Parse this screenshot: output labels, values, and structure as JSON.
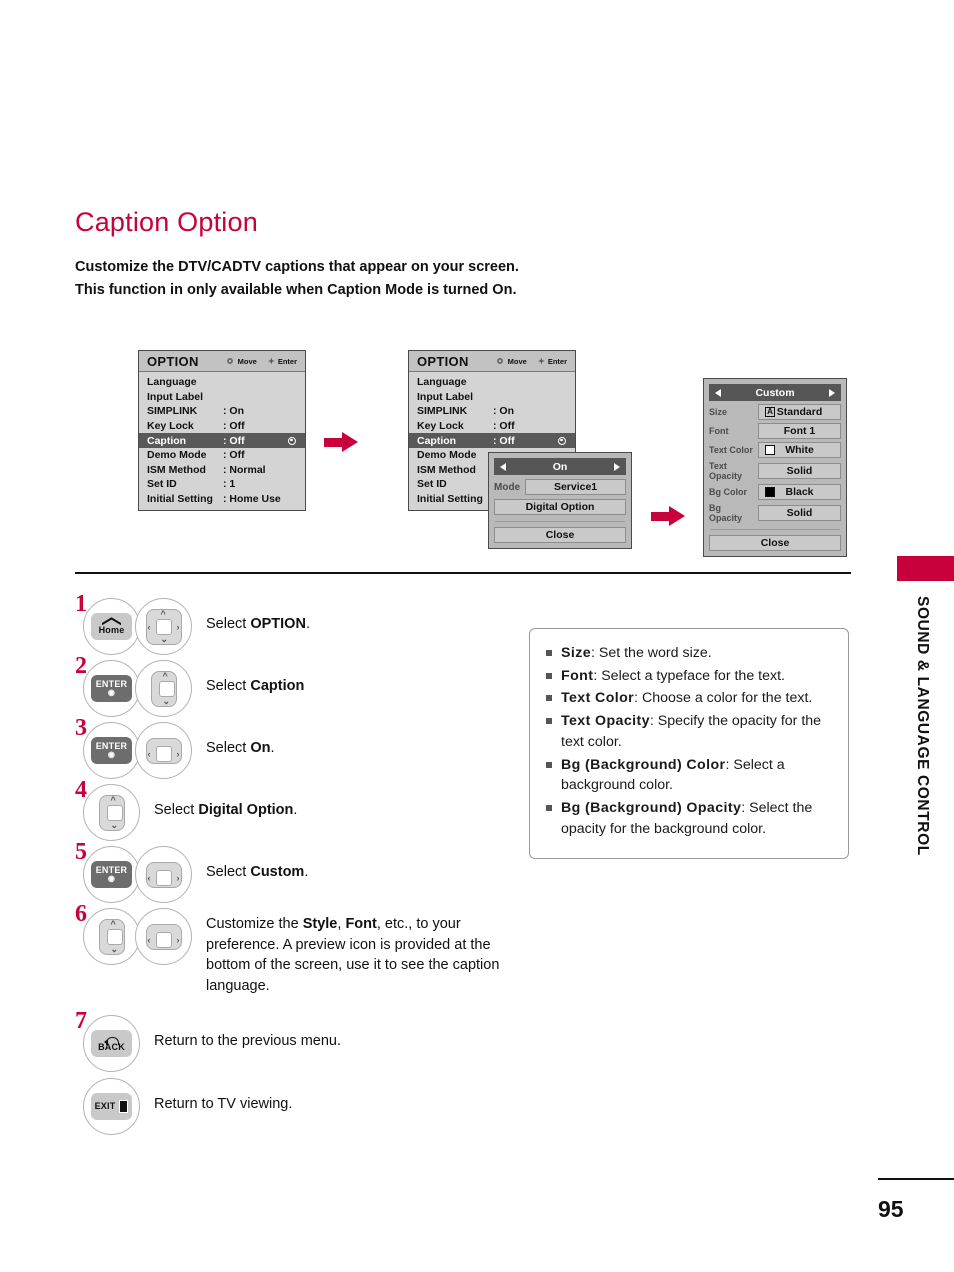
{
  "page": {
    "title": "Caption Option",
    "intro_line1": "Customize the DTV/CADTV captions that appear on your screen.",
    "intro_line2": "This function in only available when Caption Mode is turned On.",
    "side_label": "SOUND & LANGUAGE CONTROL",
    "page_number": "95",
    "accent_color": "#c8003c"
  },
  "osd1": {
    "title": "OPTION",
    "hint_move": "Move",
    "hint_enter": "Enter",
    "rows": [
      {
        "label": "Language",
        "value": ""
      },
      {
        "label": "Input Label",
        "value": ""
      },
      {
        "label": "SIMPLINK",
        "value": ": On"
      },
      {
        "label": "Key Lock",
        "value": ": Off"
      },
      {
        "label": "Caption",
        "value": ": Off"
      },
      {
        "label": "Demo Mode",
        "value": ": Off"
      },
      {
        "label": "ISM Method",
        "value": ": Normal"
      },
      {
        "label": "Set ID",
        "value": ": 1"
      },
      {
        "label": "Initial Setting",
        "value": ": Home Use"
      }
    ]
  },
  "osd2": {
    "title": "OPTION",
    "hint_move": "Move",
    "hint_enter": "Enter",
    "rows": [
      {
        "label": "Language",
        "value": ""
      },
      {
        "label": "Input Label",
        "value": ""
      },
      {
        "label": "SIMPLINK",
        "value": ": On"
      },
      {
        "label": "Key Lock",
        "value": ": Off"
      },
      {
        "label": "Caption",
        "value": ": Off"
      },
      {
        "label": "Demo Mode",
        "value": ""
      },
      {
        "label": "ISM Method",
        "value": ""
      },
      {
        "label": "Set ID",
        "value": ""
      },
      {
        "label": "Initial Setting",
        "value": ""
      }
    ]
  },
  "caption_popup": {
    "state": "On",
    "mode_label": "Mode",
    "mode_value": "Service1",
    "digital_option": "Digital Option",
    "close": "Close"
  },
  "custom_panel": {
    "title": "Custom",
    "rows": [
      {
        "label": "Size",
        "value": "Standard",
        "swatch": "letter-a-icon"
      },
      {
        "label": "Font",
        "value": "Font 1",
        "swatch": ""
      },
      {
        "label": "Text Color",
        "value": "White",
        "swatch": "white-swatch"
      },
      {
        "label": "Text Opacity",
        "value": "Solid",
        "swatch": ""
      },
      {
        "label": "Bg Color",
        "value": "Black",
        "swatch": "black-swatch"
      },
      {
        "label": "Bg Opacity",
        "value": "Solid",
        "swatch": ""
      }
    ],
    "close": "Close",
    "size_glyph": "A"
  },
  "steps": [
    {
      "num": "1",
      "keys": [
        "home-button",
        "nav-pad-4way"
      ],
      "text_html": "Select <b>OPTION</b>."
    },
    {
      "num": "2",
      "keys": [
        "enter-button",
        "nav-pad-updown"
      ],
      "text_html": "Select <b>Caption</b>"
    },
    {
      "num": "3",
      "keys": [
        "enter-button",
        "nav-pad-leftright"
      ],
      "text_html": "Select <b>On</b>."
    },
    {
      "num": "4",
      "keys": [
        "nav-pad-updown"
      ],
      "text_html": "Select <b>Digital Option</b>."
    },
    {
      "num": "5",
      "keys": [
        "enter-button",
        "nav-pad-leftright"
      ],
      "text_html": "Select <b>Custom</b>."
    },
    {
      "num": "6",
      "keys": [
        "nav-pad-updown",
        "nav-pad-leftright"
      ],
      "text_html": "Customize the <b>Style</b>, <b>Font</b>, etc., to your preference. A preview icon is provided at the bottom of the screen, use it to see the caption language."
    },
    {
      "num": "7",
      "keys": [
        "back-button"
      ],
      "text_html": "Return to the previous menu."
    },
    {
      "num": "",
      "keys": [
        "exit-button"
      ],
      "text_html": "Return to TV viewing."
    }
  ],
  "key_labels": {
    "home": "Home",
    "enter_line1": "ENTER",
    "back": "BACK",
    "exit": "EXIT"
  },
  "infobox": [
    {
      "term": "Size",
      "desc": ": Set the word size."
    },
    {
      "term": "Font",
      "desc": ": Select a typeface for the text."
    },
    {
      "term": "Text Color",
      "desc": ": Choose a color for the text."
    },
    {
      "term": "Text Opacity",
      "desc": ": Specify the opacity for the text color."
    },
    {
      "term": "Bg (Background) Color",
      "desc": ": Select a background color."
    },
    {
      "term": "Bg (Background) Opacity",
      "desc": ": Select the opacity for the background color."
    }
  ]
}
